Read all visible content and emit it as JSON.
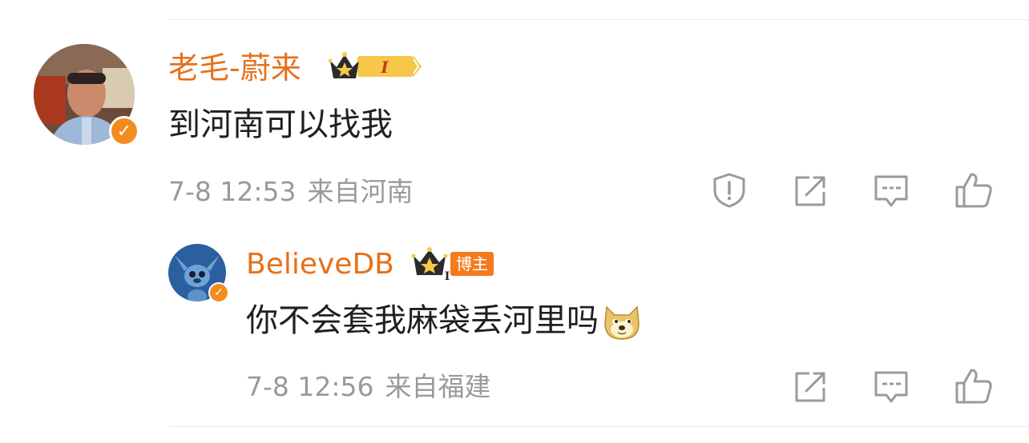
{
  "comment": {
    "username": "老毛-蔚来",
    "level_badge": "I",
    "text": "到河南可以找我",
    "time": "7-8 12:53",
    "location": "来自河南",
    "actions": [
      "report-icon",
      "repost-icon",
      "comment-icon",
      "like-icon"
    ]
  },
  "reply": {
    "username": "BelieveDB",
    "level_badge": "I",
    "role_badge": "博主",
    "text": "你不会套我麻袋丢河里吗",
    "emoji": "doge-emoji",
    "time": "7-8 12:56",
    "location": "来自福建",
    "actions": [
      "repost-icon",
      "comment-icon",
      "like-icon"
    ]
  },
  "colors": {
    "username": "#e8701a",
    "verified_badge": "#f28c1e",
    "meta_text": "#9a9a9a",
    "body_text": "#1f1f1f",
    "divider": "#e9e9e9"
  }
}
